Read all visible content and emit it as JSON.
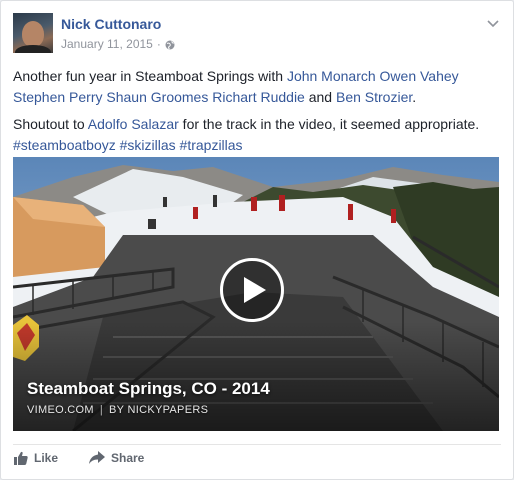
{
  "post": {
    "author": "Nick Cuttonaro",
    "date": "January 11, 2015",
    "separator": "·",
    "line1_prefix": "Another fun year in Steamboat Springs with ",
    "tagged": [
      "John Monarch",
      "Owen Vahey",
      "Stephen Perry",
      "Shaun Groomes",
      "Richart Ruddie"
    ],
    "and_word": " and ",
    "last_tagged": "Ben Strozier",
    "line1_suffix": ".",
    "shoutout_prefix": "Shoutout to ",
    "shoutout_name": "Adolfo Salazar",
    "shoutout_suffix": " for the track in the video, it seemed appropriate.",
    "hashtags": [
      "#steamboatboyz",
      "#skizillas",
      "#trapzillas"
    ]
  },
  "video": {
    "title": "Steamboat Springs, CO - 2014",
    "source": "VIMEO.COM",
    "divider": "|",
    "byline": "BY NICKYPAPERS"
  },
  "actions": {
    "like": "Like",
    "share": "Share"
  },
  "colors": {
    "link": "#365899",
    "action": "#616770",
    "meta": "#90949c"
  },
  "icons": {
    "globe": "globe-icon",
    "chevron": "chevron-down-icon",
    "play": "play-icon",
    "like": "thumbs-up-icon",
    "share": "share-arrow-icon"
  }
}
